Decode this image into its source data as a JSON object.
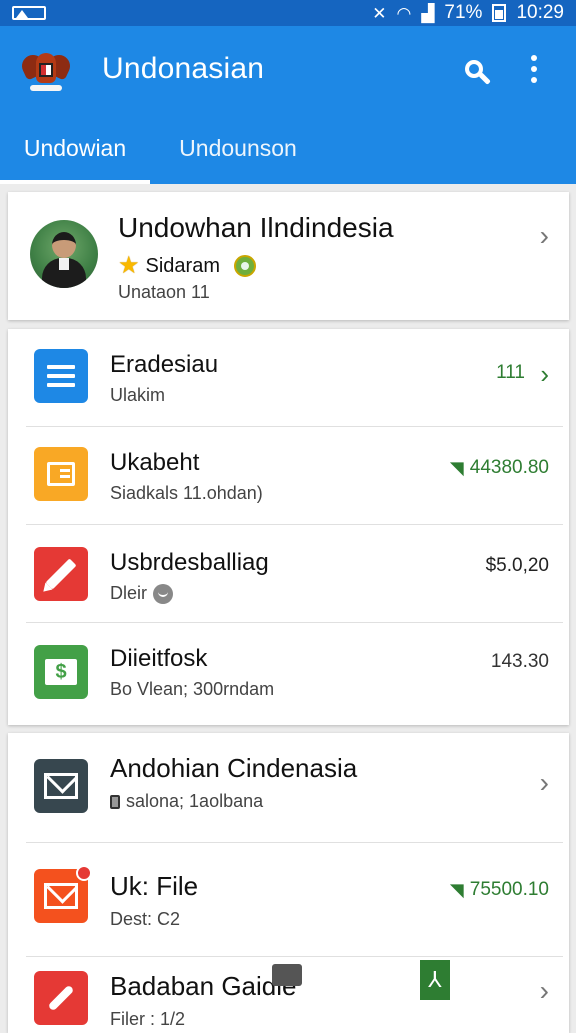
{
  "status_bar": {
    "battery_percent": "71%",
    "time": "10:29"
  },
  "app_bar": {
    "title": "Undonasian",
    "search_icon": "search-icon",
    "menu_icon": "more-vert-icon"
  },
  "tabs": [
    {
      "label": "Undowian",
      "active": true
    },
    {
      "label": "Undounson",
      "active": false
    }
  ],
  "profile": {
    "name": "Undowhan Ilndindesia",
    "badge_text": "Sidaram",
    "meta": "Unataon 11"
  },
  "list1": [
    {
      "title": "Eradesiau",
      "subtitle": "Ulakim",
      "value": "111",
      "value_color": "#2e7d32",
      "trend": false,
      "chevron": true,
      "icon_color": "#1e88e5",
      "icon": "document-icon"
    },
    {
      "title": "Ukabeht",
      "subtitle": "Siadkals 11.ohdan)",
      "value": "44380.80",
      "value_color": "#2e7d32",
      "trend": true,
      "chevron": false,
      "icon_color": "#f9a825",
      "icon": "list-icon"
    },
    {
      "title": "Usbrdesballiag",
      "subtitle": "Dleir",
      "value": "$5.0,20",
      "value_color": "#222",
      "trend": false,
      "chevron": false,
      "icon_color": "#e53935",
      "icon": "pencil-icon"
    },
    {
      "title": "Diieitfosk",
      "subtitle": "Bo Vlean; 300rndam",
      "value": "143.30",
      "value_color": "#333",
      "trend": false,
      "chevron": false,
      "icon_color": "#43a047",
      "icon": "dollar-icon"
    }
  ],
  "list2": [
    {
      "title": "Andohian Cindenasia",
      "subtitle": "salona; 1aolbana",
      "value": "",
      "chevron": true,
      "icon_color": "#37474f",
      "icon": "mail-icon"
    },
    {
      "title": "Uk: File",
      "subtitle": "Dest: C2",
      "value": "75500.10",
      "value_color": "#2e7d32",
      "trend": true,
      "chevron": false,
      "icon_color": "#f4511e",
      "icon": "mail-notify-icon"
    },
    {
      "title": "Badaban Gaidle",
      "subtitle": "Filer : 1/2",
      "value": "",
      "chevron": true,
      "icon_color": "#e53935",
      "icon": "tool-icon"
    }
  ]
}
